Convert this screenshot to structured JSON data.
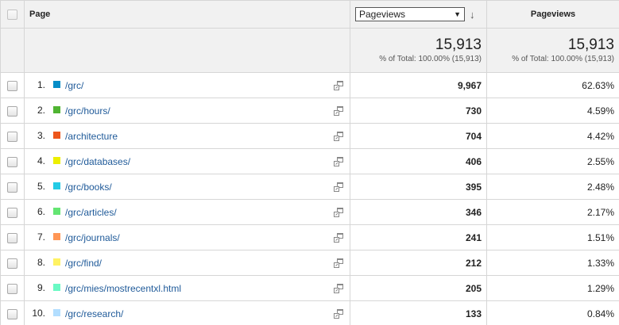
{
  "header": {
    "page_label": "Page",
    "metric_select_value": "Pageviews",
    "sort_arrow": "↓",
    "pct_header": "Pageviews"
  },
  "totals": {
    "pageviews_total": "15,913",
    "pageviews_sub": "% of Total: 100.00% (15,913)",
    "pct_total": "15,913",
    "pct_sub": "% of Total: 100.00% (15,913)"
  },
  "rows": [
    {
      "index": "1.",
      "color": "#058dc7",
      "page": "/grc/",
      "pageviews": "9,967",
      "percent": "62.63%"
    },
    {
      "index": "2.",
      "color": "#50b432",
      "page": "/grc/hours/",
      "pageviews": "730",
      "percent": "4.59%"
    },
    {
      "index": "3.",
      "color": "#ed561b",
      "page": "/architecture",
      "pageviews": "704",
      "percent": "4.42%"
    },
    {
      "index": "4.",
      "color": "#edef00",
      "page": "/grc/databases/",
      "pageviews": "406",
      "percent": "2.55%"
    },
    {
      "index": "5.",
      "color": "#24cbe5",
      "page": "/grc/books/",
      "pageviews": "395",
      "percent": "2.48%"
    },
    {
      "index": "6.",
      "color": "#64e572",
      "page": "/grc/articles/",
      "pageviews": "346",
      "percent": "2.17%"
    },
    {
      "index": "7.",
      "color": "#ff9655",
      "page": "/grc/journals/",
      "pageviews": "241",
      "percent": "1.51%"
    },
    {
      "index": "8.",
      "color": "#fff263",
      "page": "/grc/find/",
      "pageviews": "212",
      "percent": "1.33%"
    },
    {
      "index": "9.",
      "color": "#6af9c4",
      "page": "/grc/mies/mostrecentxl.html",
      "pageviews": "205",
      "percent": "1.29%"
    },
    {
      "index": "10.",
      "color": "#b2deff",
      "page": "/grc/research/",
      "pageviews": "133",
      "percent": "0.84%"
    }
  ],
  "icons": {
    "row_action": "open-in-new-window-icon",
    "dropdown": "dropdown-arrow-icon",
    "sort": "sort-descending-icon"
  }
}
